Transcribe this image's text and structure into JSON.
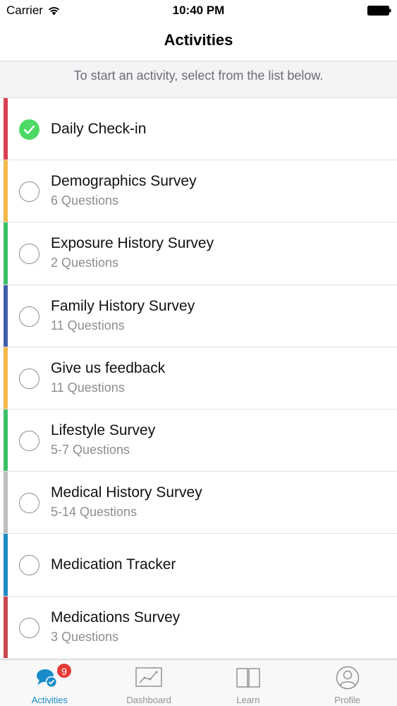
{
  "status_bar": {
    "carrier": "Carrier",
    "time": "10:40 PM"
  },
  "nav": {
    "title": "Activities"
  },
  "instructions": "To start an activity, select from the list below.",
  "activities": [
    {
      "title": "Daily Check-in",
      "subtitle": "",
      "completed": true,
      "color": "#d94152"
    },
    {
      "title": "Demographics Survey",
      "subtitle": "6 Questions",
      "completed": false,
      "color": "#f2b84b"
    },
    {
      "title": "Exposure History Survey",
      "subtitle": "2 Questions",
      "completed": false,
      "color": "#3cc168"
    },
    {
      "title": "Family History Survey",
      "subtitle": "11 Questions",
      "completed": false,
      "color": "#3f5ea8"
    },
    {
      "title": "Give us feedback",
      "subtitle": "11 Questions",
      "completed": false,
      "color": "#f2b84b"
    },
    {
      "title": "Lifestyle Survey",
      "subtitle": "5-7 Questions",
      "completed": false,
      "color": "#3cc168"
    },
    {
      "title": "Medical History Survey",
      "subtitle": "5-14 Questions",
      "completed": false,
      "color": "#bdbdbd"
    },
    {
      "title": "Medication Tracker",
      "subtitle": "",
      "completed": false,
      "color": "#1e8bc3"
    },
    {
      "title": "Medications Survey",
      "subtitle": "3 Questions",
      "completed": false,
      "color": "#c9474e"
    }
  ],
  "tabs": [
    {
      "label": "Activities",
      "icon": "activities-chat-icon",
      "active": true,
      "badge": "9"
    },
    {
      "label": "Dashboard",
      "icon": "dashboard-chart-icon",
      "active": false,
      "badge": ""
    },
    {
      "label": "Learn",
      "icon": "learn-book-icon",
      "active": false,
      "badge": ""
    },
    {
      "label": "Profile",
      "icon": "profile-person-icon",
      "active": false,
      "badge": ""
    }
  ],
  "colors": {
    "accent": "#1a8cc9",
    "completed": "#4cd964",
    "badge": "#e53935"
  }
}
